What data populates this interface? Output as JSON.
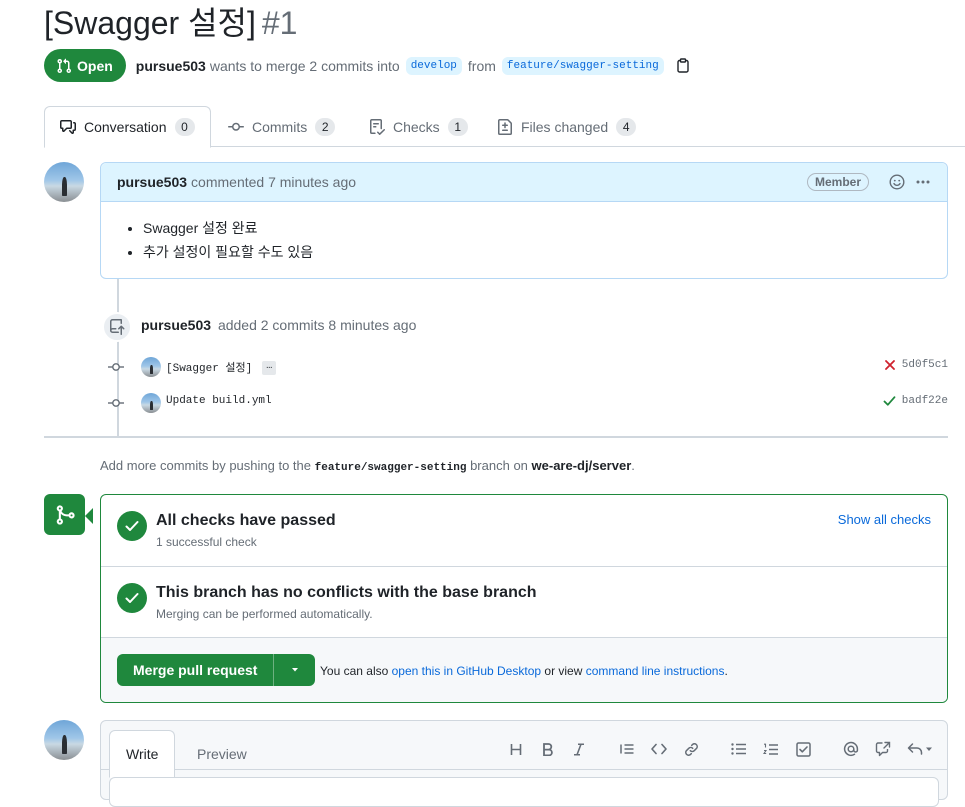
{
  "pr": {
    "title": "[Swagger 설정]",
    "number": "#1",
    "state": "Open",
    "author": "pursue503",
    "summary_text": "wants to merge 2 commits into",
    "base_branch": "develop",
    "from_text": "from",
    "head_branch": "feature/swagger-setting"
  },
  "tabs": [
    {
      "label": "Conversation",
      "count": "0",
      "icon": "comment-discussion-icon",
      "selected": true
    },
    {
      "label": "Commits",
      "count": "2",
      "icon": "git-commit-icon"
    },
    {
      "label": "Checks",
      "count": "1",
      "icon": "checklist-icon"
    },
    {
      "label": "Files changed",
      "count": "4",
      "icon": "file-diff-icon"
    }
  ],
  "comment": {
    "author": "pursue503",
    "action": "commented 7 minutes ago",
    "role_label": "Member",
    "body_items": [
      "Swagger 설정 완료",
      "추가 설정이 필요할 수도 있음"
    ]
  },
  "commits_event": {
    "author": "pursue503",
    "action": "added 2 commits 8 minutes ago",
    "commits": [
      {
        "message": "[Swagger 설정]",
        "has_more": true,
        "more_label": "…",
        "status": "failure",
        "sha": "5d0f5c1"
      },
      {
        "message": "Update build.yml",
        "has_more": false,
        "status": "success",
        "sha": "badf22e"
      }
    ]
  },
  "push_note": {
    "prefix": "Add more commits by pushing to the",
    "branch": "feature/swagger-setting",
    "middle": "branch on",
    "repo": "we-are-dj/server",
    "suffix": "."
  },
  "merge_box": {
    "checks_title": "All checks have passed",
    "checks_sub": "1 successful check",
    "show_checks": "Show all checks",
    "conflicts_title": "This branch has no conflicts with the base branch",
    "conflicts_sub": "Merging can be performed automatically.",
    "merge_button": "Merge pull request",
    "alt_prefix": "You can also",
    "alt_link_desktop": "open this in GitHub Desktop",
    "alt_or": "or view",
    "alt_link_cli": "command line instructions",
    "alt_suffix": "."
  },
  "composer": {
    "tab_write": "Write",
    "tab_preview": "Preview",
    "toolbar": [
      "heading-icon",
      "bold-icon",
      "italic-icon",
      "quote-icon",
      "code-icon",
      "link-icon",
      "unordered-list-icon",
      "ordered-list-icon",
      "task-list-icon",
      "mention-icon",
      "cross-reference-icon",
      "reply-icon"
    ]
  },
  "colors": {
    "green": "#1f883d",
    "blue": "#0969da",
    "red": "#cf222e",
    "muted": "#656d76"
  }
}
